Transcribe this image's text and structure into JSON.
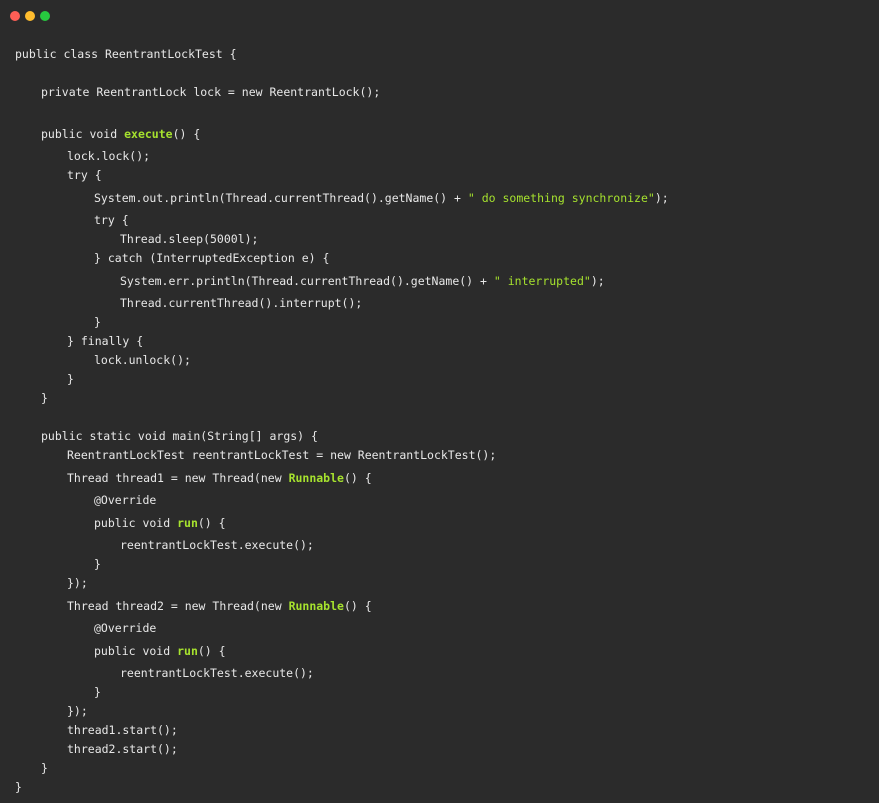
{
  "window": {
    "controls": [
      {
        "name": "close",
        "color": "#ff5f56"
      },
      {
        "name": "minimize",
        "color": "#ffbd2e"
      },
      {
        "name": "zoom",
        "color": "#27c93f"
      }
    ]
  },
  "code": {
    "language": "java",
    "lines": [
      {
        "indent": 0,
        "segments": [
          {
            "t": "public class ReentrantLockTest {",
            "k": "plain"
          }
        ]
      },
      {
        "indent": 1,
        "segments": [
          {
            "t": "private ReentrantLock lock = new ReentrantLock();",
            "k": "plain"
          }
        ]
      },
      {
        "indent": 1,
        "segments": [
          {
            "t": "public void ",
            "k": "plain"
          },
          {
            "t": "execute",
            "k": "method"
          },
          {
            "t": "() {",
            "k": "plain"
          }
        ]
      },
      {
        "indent": 2,
        "segments": [
          {
            "t": "lock.lock();",
            "k": "plain"
          }
        ]
      },
      {
        "indent": 2,
        "segments": [
          {
            "t": "try {",
            "k": "plain"
          }
        ]
      },
      {
        "indent": 3,
        "segments": [
          {
            "t": "System.out.println(Thread.currentThread().getName() + ",
            "k": "plain"
          },
          {
            "t": "\" do something synchronize\"",
            "k": "string"
          },
          {
            "t": ");",
            "k": "plain"
          }
        ]
      },
      {
        "indent": 3,
        "segments": [
          {
            "t": "try {",
            "k": "plain"
          }
        ]
      },
      {
        "indent": 4,
        "segments": [
          {
            "t": "Thread.sleep(5000l);",
            "k": "plain"
          }
        ]
      },
      {
        "indent": 3,
        "segments": [
          {
            "t": "} catch (InterruptedException e) {",
            "k": "plain"
          }
        ]
      },
      {
        "indent": 4,
        "segments": [
          {
            "t": "System.err.println(Thread.currentThread().getName() + ",
            "k": "plain"
          },
          {
            "t": "\" interrupted\"",
            "k": "string"
          },
          {
            "t": ");",
            "k": "plain"
          }
        ]
      },
      {
        "indent": 4,
        "segments": [
          {
            "t": "Thread.currentThread().interrupt();",
            "k": "plain"
          }
        ]
      },
      {
        "indent": 3,
        "segments": [
          {
            "t": "}",
            "k": "plain"
          }
        ]
      },
      {
        "indent": 2,
        "segments": [
          {
            "t": "} finally {",
            "k": "plain"
          }
        ]
      },
      {
        "indent": 3,
        "segments": [
          {
            "t": "lock.unlock();",
            "k": "plain"
          }
        ]
      },
      {
        "indent": 2,
        "segments": [
          {
            "t": "}",
            "k": "plain"
          }
        ]
      },
      {
        "indent": 1,
        "segments": [
          {
            "t": "}",
            "k": "plain"
          }
        ]
      },
      {
        "indent": 1,
        "segments": [
          {
            "t": "public static void main(String[] args) {",
            "k": "plain"
          }
        ]
      },
      {
        "indent": 2,
        "segments": [
          {
            "t": "ReentrantLockTest reentrantLockTest = new ReentrantLockTest();",
            "k": "plain"
          }
        ]
      },
      {
        "indent": 2,
        "segments": [
          {
            "t": "Thread thread1 = new Thread(new ",
            "k": "plain"
          },
          {
            "t": "Runnable",
            "k": "method"
          },
          {
            "t": "() {",
            "k": "plain"
          }
        ]
      },
      {
        "indent": 3,
        "segments": [
          {
            "t": "@Override",
            "k": "anno"
          }
        ]
      },
      {
        "indent": 3,
        "segments": [
          {
            "t": "public void ",
            "k": "plain"
          },
          {
            "t": "run",
            "k": "method"
          },
          {
            "t": "() {",
            "k": "plain"
          }
        ]
      },
      {
        "indent": 4,
        "segments": [
          {
            "t": "reentrantLockTest.execute();",
            "k": "plain"
          }
        ]
      },
      {
        "indent": 3,
        "segments": [
          {
            "t": "}",
            "k": "plain"
          }
        ]
      },
      {
        "indent": 2,
        "segments": [
          {
            "t": "});",
            "k": "plain"
          }
        ]
      },
      {
        "indent": 2,
        "segments": [
          {
            "t": "Thread thread2 = new Thread(new ",
            "k": "plain"
          },
          {
            "t": "Runnable",
            "k": "method"
          },
          {
            "t": "() {",
            "k": "plain"
          }
        ]
      },
      {
        "indent": 3,
        "segments": [
          {
            "t": "@Override",
            "k": "anno"
          }
        ]
      },
      {
        "indent": 3,
        "segments": [
          {
            "t": "public void ",
            "k": "plain"
          },
          {
            "t": "run",
            "k": "method"
          },
          {
            "t": "() {",
            "k": "plain"
          }
        ]
      },
      {
        "indent": 4,
        "segments": [
          {
            "t": "reentrantLockTest.execute();",
            "k": "plain"
          }
        ]
      },
      {
        "indent": 3,
        "segments": [
          {
            "t": "}",
            "k": "plain"
          }
        ]
      },
      {
        "indent": 2,
        "segments": [
          {
            "t": "});",
            "k": "plain"
          }
        ]
      },
      {
        "indent": 2,
        "segments": [
          {
            "t": "thread1.start();",
            "k": "plain"
          }
        ]
      },
      {
        "indent": 2,
        "segments": [
          {
            "t": "thread2.start();",
            "k": "plain"
          }
        ]
      },
      {
        "indent": 1,
        "segments": [
          {
            "t": "}",
            "k": "plain"
          }
        ]
      },
      {
        "indent": 0,
        "segments": [
          {
            "t": "}",
            "k": "plain"
          }
        ]
      }
    ]
  }
}
